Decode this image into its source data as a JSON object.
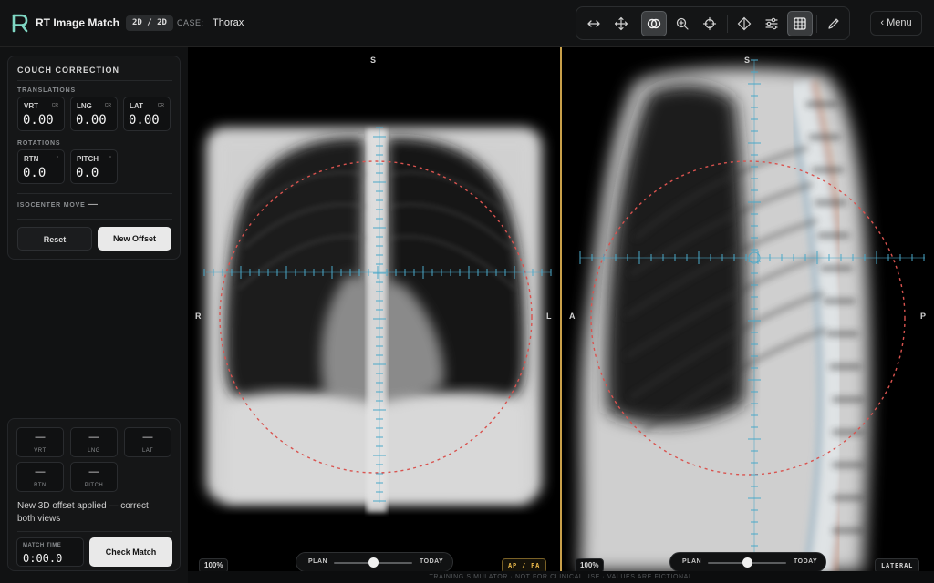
{
  "app": {
    "title": "RT Image Match",
    "mode": "2D / 2D",
    "case_label": "CASE:",
    "case_value": "Thorax",
    "menu_label": "‹ Menu"
  },
  "toolbar": {
    "tools": [
      "horizontal-arrows-icon",
      "move-icon",
      "overlay-icon",
      "zoom-icon",
      "crosshair-icon",
      "isocenter-icon",
      "sliders-icon",
      "grid-icon",
      "pencil-icon"
    ],
    "active": [
      "overlay-icon",
      "grid-icon"
    ]
  },
  "couch": {
    "title": "COUCH CORRECTION",
    "translations_label": "TRANSLATIONS",
    "rotations_label": "ROTATIONS",
    "translations": [
      {
        "label": "VRT",
        "unit": "CR",
        "value": "0.00"
      },
      {
        "label": "LNG",
        "unit": "CR",
        "value": "0.00"
      },
      {
        "label": "LAT",
        "unit": "CR",
        "value": "0.00"
      }
    ],
    "rotations": [
      {
        "label": "RTN",
        "unit": "°",
        "value": "0.0"
      },
      {
        "label": "PITCH",
        "unit": "°",
        "value": "0.0"
      }
    ],
    "isocenter_label": "ISOCENTER MOVE",
    "isocenter_value": "—",
    "reset_label": "Reset",
    "new_offset_label": "New Offset"
  },
  "match": {
    "fields": [
      {
        "value": "—",
        "label": "VRT"
      },
      {
        "value": "—",
        "label": "LNG"
      },
      {
        "value": "—",
        "label": "LAT"
      },
      {
        "value": "—",
        "label": "RTN"
      },
      {
        "value": "—",
        "label": "PITCH"
      }
    ],
    "message": "New 3D offset applied — correct both views",
    "time_label": "MATCH TIME",
    "time_value": "0:00.0",
    "check_label": "Check Match"
  },
  "views": {
    "ap": {
      "top": "S",
      "left": "R",
      "right": "L",
      "zoom": "100%",
      "plan": "PLAN",
      "today": "TODAY",
      "blend": 0.5,
      "tag": "AP / PA"
    },
    "lat": {
      "top": "S",
      "left": "A",
      "right": "P",
      "zoom": "100%",
      "plan": "PLAN",
      "today": "TODAY",
      "blend": 0.5,
      "tag": "LATERAL"
    }
  },
  "footer": "TRAINING SIMULATOR · NOT FOR CLINICAL USE · VALUES ARE FICTIONAL",
  "colors": {
    "accent": "#e9b84a",
    "target_ring": "#d9534f",
    "crosshair": "#4aa8c8",
    "bg": "#0c0d0e"
  }
}
